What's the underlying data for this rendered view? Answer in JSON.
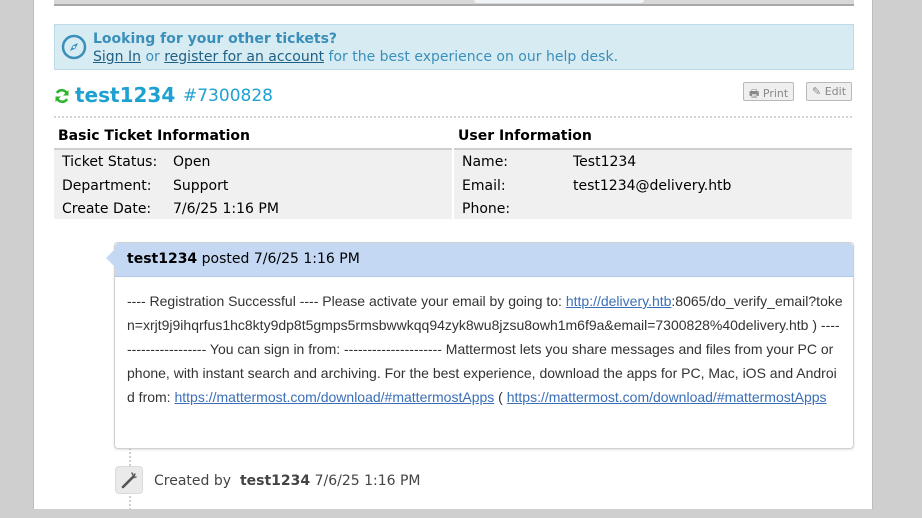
{
  "notice": {
    "title": "Looking for your other tickets?",
    "sign_in": "Sign In",
    "or": "or",
    "register": "register for an account",
    "suffix": "for the best experience on our help desk."
  },
  "ticket": {
    "name": "test1234",
    "number": "#7300828",
    "print_label": "Print",
    "edit_label": "Edit"
  },
  "basic_info": {
    "title": "Basic Ticket Information",
    "rows": [
      {
        "label": "Ticket Status:",
        "value": "Open"
      },
      {
        "label": "Department:",
        "value": "Support"
      },
      {
        "label": "Create Date:",
        "value": "7/6/25 1:16 PM"
      }
    ]
  },
  "user_info": {
    "title": "User Information",
    "rows": [
      {
        "label": "Name:",
        "value": "Test1234"
      },
      {
        "label": "Email:",
        "value": "test1234@delivery.htb"
      },
      {
        "label": "Phone:",
        "value": ""
      }
    ]
  },
  "entry": {
    "author": "test1234",
    "posted": "posted",
    "time": "7/6/25 1:16 PM",
    "body_part1": "---- Registration Successful ---- Please activate your email by going to: ",
    "link1": "http://delivery.htb",
    "body_part2": ":8065/do_verify_email?token=xrjt9j9ihqrfus1hc8kty9dp8t5gmps5rmsbwwkqq94zyk8wu8jzsu8owh1m6f9a&email=7300828%40delivery.htb ) --------------------- You can sign in from: --------------------- Mattermost lets you share messages and files from your PC or phone, with instant search and archiving. For the best experience, download the apps for PC, Mac, iOS and Android from: ",
    "link2": "https://mattermost.com/download/#mattermostApps",
    "body_part3": " ( ",
    "link3": "https://mattermost.com/download/#mattermostApps"
  },
  "event": {
    "prefix": "Created by",
    "author": "test1234",
    "time": "7/6/25 1:16 PM"
  },
  "colors": {
    "accent": "#1ea1d1",
    "notice_bg": "#d7ebf3",
    "entry_header_bg": "#c4d8f4",
    "refresh_icon": "#2db52d"
  },
  "icons": [
    "compass-icon",
    "refresh-icon",
    "print-icon",
    "edit-icon",
    "edit-event-icon"
  ]
}
